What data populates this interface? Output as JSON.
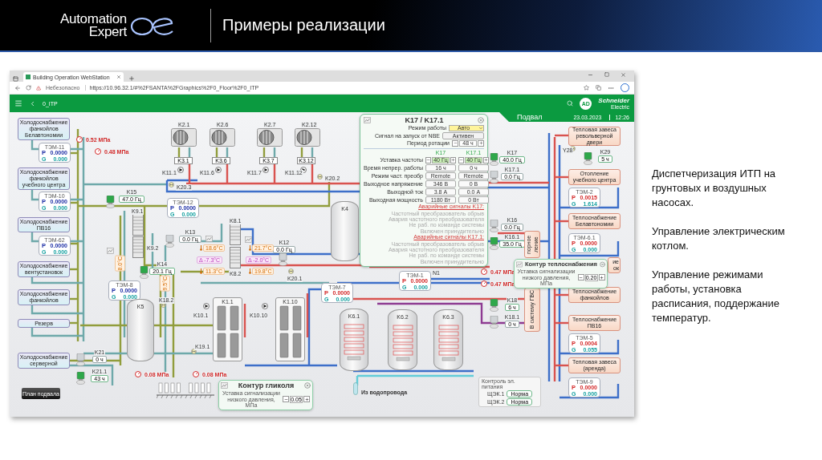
{
  "slide": {
    "logo": {
      "line1": "Automation",
      "line2": "Expert"
    },
    "title": "Примеры реализации"
  },
  "browser": {
    "tab_title": "Building Operation WebStation",
    "warning": "Небезопасно",
    "url": "https://10.96.32.1/#%2FSANTA%2FGraphics%2F0_Floor%2F0_ITP"
  },
  "app_bar": {
    "breadcrumb": "0_ITP",
    "avatar": "AD",
    "brand": "Schneider",
    "brand_sub": "Electric"
  },
  "floor_banner": {
    "floor": "Подвал",
    "date": "23.03.2023",
    "time": "12:26"
  },
  "consumers": [
    {
      "name": "Холодоснабжение фанкойлов Белавтономии",
      "kind": "cold"
    },
    {
      "name": "Холодоснабжение фанкойлов учебного центра",
      "kind": "cold"
    },
    {
      "name": "Холодоснабжение ПВ16",
      "kind": "cold"
    },
    {
      "name": "Холодоснабжение вентустановок",
      "kind": "cold"
    },
    {
      "name": "Холодоснабжение фанкойлов",
      "kind": "cold"
    },
    {
      "name": "Резерв",
      "kind": "cold"
    },
    {
      "name": "Холодоснабжение серверной",
      "kind": "cold"
    },
    {
      "name": "Тепловая завеса револьверной двери",
      "kind": "heat"
    },
    {
      "name": "Отопление учебного центра",
      "kind": "heat"
    },
    {
      "name": "Теплоснабжение Белавтономии",
      "kind": "heat"
    },
    {
      "name": "Теплоснабжение фанкойлов",
      "kind": "heat"
    },
    {
      "name": "Теплоснабжение ПВ16",
      "kind": "heat"
    },
    {
      "name": "Тепловая завеса (аренда)",
      "kind": "heat"
    }
  ],
  "covered_box": {
    "text": "ие ок"
  },
  "meters": [
    {
      "id": "ТЭМ-11",
      "kind": "cold",
      "p_label": "P",
      "p": "0.0000",
      "g_label": "G",
      "g": "0.000"
    },
    {
      "id": "ТЭМ-10",
      "kind": "cold",
      "p_label": "P",
      "p": "0.0000",
      "g_label": "G",
      "g": "0.000"
    },
    {
      "id": "ТЭМ-62",
      "kind": "cold",
      "p_label": "P",
      "p": "0.0000",
      "g_label": "G",
      "g": "0.000"
    },
    {
      "id": "ТЭМ-12",
      "kind": "cold",
      "p_label": "P",
      "p": "0.0000",
      "g_label": "G",
      "g": "0.000"
    },
    {
      "id": "ТЭМ-8",
      "kind": "cold",
      "p_label": "P",
      "p": "0.0000",
      "g_label": "G",
      "g": "0.000"
    },
    {
      "id": "ТЭМ-7",
      "kind": "heat",
      "p_label": "P",
      "p": "0.0000",
      "g_label": "G",
      "g": "0.000"
    },
    {
      "id": "ТЭМ-1",
      "kind": "heat",
      "p_label": "P",
      "p": "0.0000",
      "g_label": "G",
      "g": "0.000"
    },
    {
      "id": "ТЭМ-2",
      "kind": "heat",
      "p_label": "P",
      "p": "0.0015",
      "g_label": "G",
      "g": "1.614"
    },
    {
      "id": "ТЭМ-6.1",
      "kind": "heat",
      "p_label": "P",
      "p": "0.0000",
      "g_label": "G",
      "g": "0.000"
    },
    {
      "id": "ТЭМ-5",
      "kind": "heat",
      "p_label": "P",
      "p": "0.0004",
      "g_label": "G",
      "g": "0.055"
    },
    {
      "id": "ТЭМ-9",
      "kind": "heat",
      "p_label": "P",
      "p": "0.0000",
      "g_label": "G",
      "g": "0.000"
    }
  ],
  "drives": [
    {
      "name": "K15",
      "value": "47.0 Гц",
      "running": true
    },
    {
      "name": "K14",
      "value": "20.1 Гц",
      "running": true
    },
    {
      "name": "K13",
      "value": "0.0 Гц",
      "running": false
    },
    {
      "name": "K12",
      "value": "0.0 Гц",
      "running": false
    },
    {
      "name": "K17",
      "value": "40.0 Гц",
      "running": true
    },
    {
      "name": "K17.1",
      "value": "0.0 Гц",
      "running": false
    },
    {
      "name": "K16",
      "value": "0.0 Гц",
      "running": false
    },
    {
      "name": "K16.1",
      "value": "35.0 Гц",
      "running": true
    },
    {
      "name": "K18",
      "value": "6 ч",
      "running": true
    },
    {
      "name": "K18.1",
      "value": "0 ч",
      "running": false
    },
    {
      "name": "K21",
      "value": "0 ч",
      "running": false
    },
    {
      "name": "K21.1",
      "value": "43 ч",
      "running": true
    },
    {
      "name": "K29",
      "value": "5 ч",
      "running": true
    }
  ],
  "pressures": [
    "0.52 МПа",
    "0.48 МПа",
    "0.08 МПа",
    "0.08 МПа",
    "0.47 МПа",
    "0.47 МПа"
  ],
  "temperatures": [
    {
      "value": "18.6°C",
      "kind": "reading"
    },
    {
      "value": "Δ -7.3°C",
      "kind": "delta"
    },
    {
      "value": "11.3°C",
      "kind": "reading"
    },
    {
      "value": "21.7°C",
      "kind": "reading"
    },
    {
      "value": "Δ -2.0°C",
      "kind": "delta"
    },
    {
      "value": "19.8°C",
      "kind": "reading"
    },
    {
      "value": "8.0°C",
      "kind": "vertical"
    },
    {
      "value": "9.5°C",
      "kind": "vertical"
    }
  ],
  "outdoor_units": [
    "K2.1",
    "K2.6",
    "K2.7",
    "K2.12"
  ],
  "relays": [
    "K3.1",
    "K3.6",
    "K3.7",
    "K3.12"
  ],
  "circulators": [
    "K11.1",
    "K11.6",
    "K11.7",
    "K11.12",
    "K10.1",
    "K10.10"
  ],
  "valves": [
    "K20.3",
    "K20.2",
    "K20.1",
    "K18.2",
    "K19.1",
    "Y28"
  ],
  "exchangers": [
    "K9.1",
    "K9.2",
    "K8.1",
    "K8.2"
  ],
  "tanks": [
    {
      "name": "K5",
      "kind": "storage"
    },
    {
      "name": "K4",
      "kind": "storage"
    },
    {
      "name": "K6.1",
      "kind": "heater"
    },
    {
      "name": "K6.2",
      "kind": "heater"
    },
    {
      "name": "K6.3",
      "kind": "heater"
    }
  ],
  "boilers": [
    "K1.1",
    "K1.10"
  ],
  "collector": "N1",
  "vertical_boxes": [
    "порное ление",
    "В систему ГВС"
  ],
  "water_inlet": "Из водопровода",
  "floor_plan_button": "План подвала",
  "popup": {
    "title": "K17 / K17.1",
    "settings": [
      {
        "label": "Режим работы",
        "kind": "select",
        "value": "Авто"
      },
      {
        "label": "Сигнал на запуск от NBE",
        "kind": "status",
        "value": "Активен"
      },
      {
        "label": "Период ротации",
        "kind": "stepper",
        "value": "48 ч"
      }
    ],
    "columns": [
      "K17",
      "K17.1"
    ],
    "rows": [
      {
        "label": "Уставка частоты",
        "kind": "stepper",
        "values": [
          "40 Гц",
          "40 Гц"
        ]
      },
      {
        "label": "Время непрер. работы",
        "kind": "value",
        "values": [
          "16 ч",
          "0 ч"
        ]
      },
      {
        "label": "Режим част. преобр",
        "kind": "value",
        "values": [
          "Remote",
          "Remote"
        ]
      },
      {
        "label": "Выходное напряжение",
        "kind": "value",
        "values": [
          "346 В",
          "0 В"
        ]
      },
      {
        "label": "Выходной ток",
        "kind": "value",
        "values": [
          "3.8 А",
          "0.0 А"
        ]
      },
      {
        "label": "Выходная мощность",
        "kind": "value",
        "values": [
          "1180 Вт",
          "0 Вт"
        ]
      }
    ],
    "alarm_groups": [
      {
        "title": "Аварийные сигналы K17:",
        "alarms": [
          {
            "text": "Частотный преобразователь обрыв",
            "active": false
          },
          {
            "text": "Авария частотного преобразователя",
            "active": false
          },
          {
            "text": "Не раб. по команде системы",
            "active": false
          },
          {
            "text": "Включен принудительно",
            "active": false
          }
        ]
      },
      {
        "title": "Аварийные сигналы K17.1:",
        "alarms": [
          {
            "text": "Частотный преобразователь обрыв",
            "active": false
          },
          {
            "text": "Авария частотного преобразователя",
            "active": false
          },
          {
            "text": "Не раб. по команде системы",
            "active": false
          },
          {
            "text": "Включен принудительно",
            "active": false
          }
        ]
      }
    ]
  },
  "setpoint_panels": [
    {
      "title": "Контур гликоля",
      "label": "Уставка сигнализации низкого давления, МПа",
      "value": "0.05"
    },
    {
      "title": "Контур теплоснабжения",
      "label": "Уставка сигнализации низкого давления, МПа",
      "value": "0.20"
    }
  ],
  "power_panel": {
    "title": "Контроль эл. питания",
    "rows": [
      {
        "name": "ЩЭК.1",
        "status": "Норма"
      },
      {
        "name": "ЩЭК.2",
        "status": "Норма"
      }
    ]
  },
  "description": [
    "Диспетчеризация ИТП на грунтовых и воздушных насосах.",
    "Управление электрическим котлом.",
    "Управление режимами работы, установка расписания, поддержание температур."
  ]
}
